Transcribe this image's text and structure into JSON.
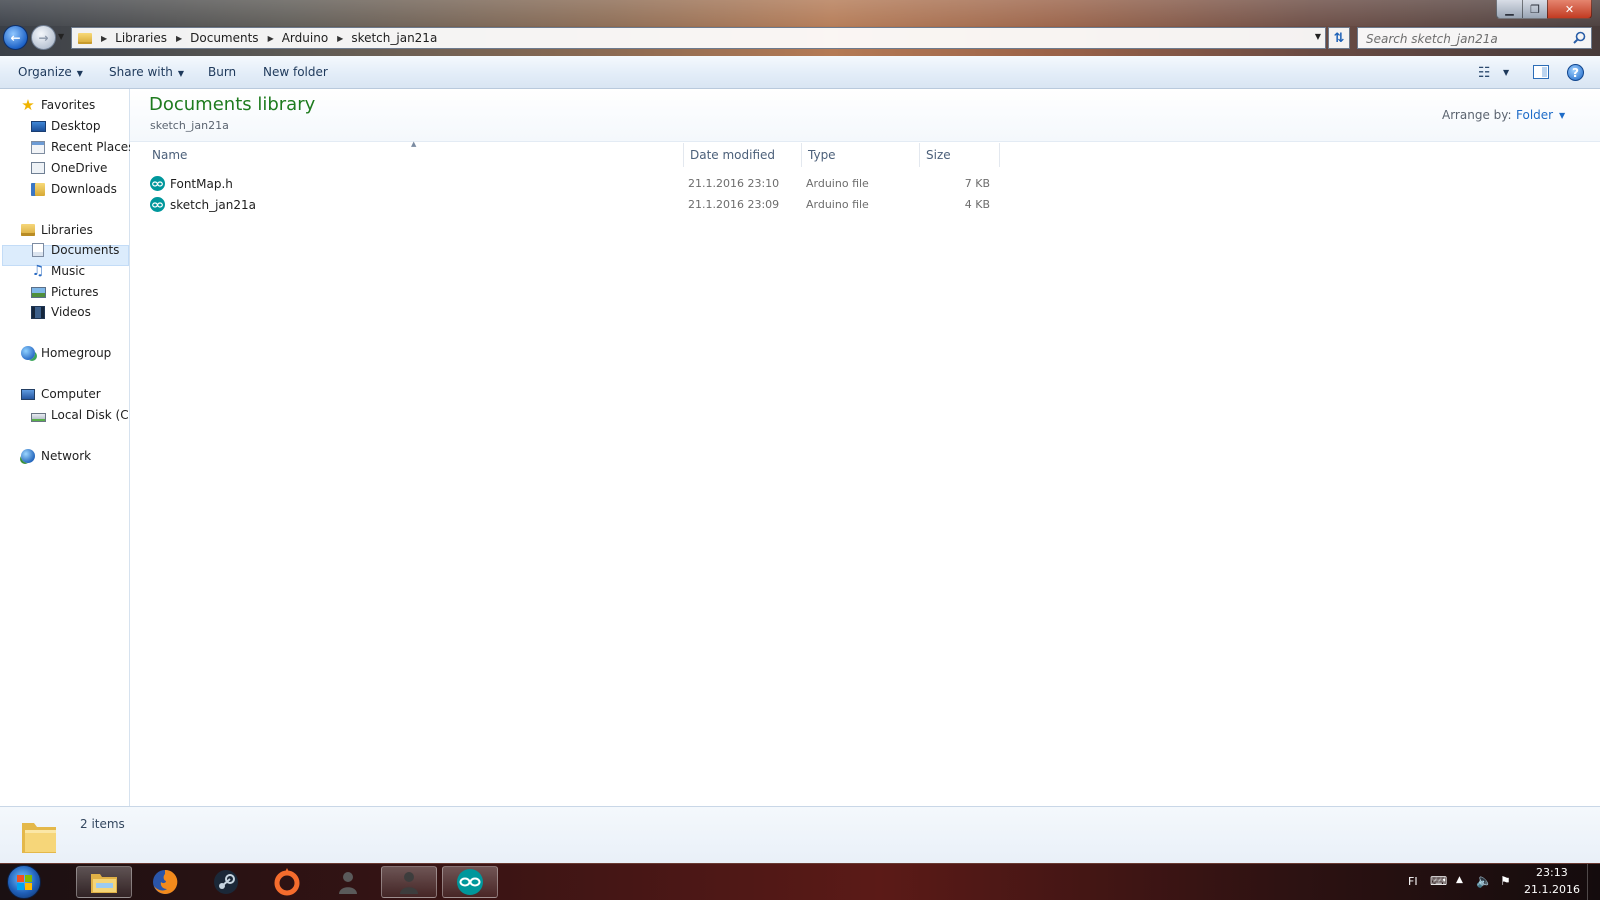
{
  "window": {
    "minimize_glyph": "▁",
    "maximize_glyph": "❐",
    "close_glyph": "✕"
  },
  "address_bar": {
    "crumbs": [
      "Libraries",
      "Documents",
      "Arduino",
      "sketch_jan21a"
    ],
    "search_placeholder": "Search sketch_jan21a"
  },
  "toolbar": {
    "organize": "Organize",
    "share_with": "Share with",
    "burn": "Burn",
    "new_folder": "New folder"
  },
  "nav": {
    "favorites": "Favorites",
    "desktop": "Desktop",
    "recent_places": "Recent Places",
    "onedrive": "OneDrive",
    "downloads": "Downloads",
    "libraries": "Libraries",
    "documents": "Documents",
    "music": "Music",
    "pictures": "Pictures",
    "videos": "Videos",
    "homegroup": "Homegroup",
    "computer": "Computer",
    "local_disk": "Local Disk (C:)",
    "network": "Network"
  },
  "library": {
    "title": "Documents library",
    "subtitle": "sketch_jan21a",
    "arrange_label": "Arrange by:",
    "arrange_value": "Folder"
  },
  "columns": {
    "name": "Name",
    "date_modified": "Date modified",
    "type": "Type",
    "size": "Size"
  },
  "files": [
    {
      "name": "FontMap.h",
      "date_modified": "21.1.2016 23:10",
      "type": "Arduino file",
      "size": "7 KB"
    },
    {
      "name": "sketch_jan21a",
      "date_modified": "21.1.2016 23:09",
      "type": "Arduino file",
      "size": "4 KB"
    }
  ],
  "details": {
    "item_count": "2 items"
  },
  "taskbar": {
    "apps": [
      "windows-explorer",
      "firefox",
      "steam",
      "origin",
      "user-app",
      "user-app-2",
      "arduino"
    ],
    "language": "FI",
    "time": "23:13",
    "date": "21.1.2016"
  },
  "colors": {
    "library_title": "#1e7b1e",
    "link_blue": "#1e6cc8",
    "arduino_teal": "#00979c",
    "selection": "#dcecfc"
  }
}
